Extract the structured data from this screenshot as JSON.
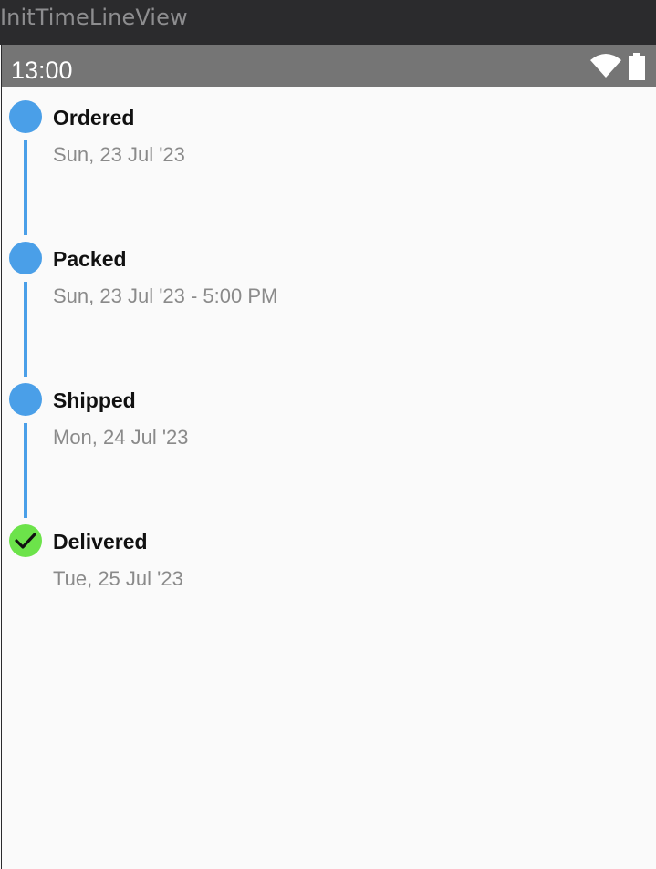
{
  "window": {
    "title": "InitTimeLineView"
  },
  "statusbar": {
    "time": "13:00",
    "icons": [
      "wifi-icon",
      "battery-icon"
    ]
  },
  "timeline": {
    "line_color": "#4a9fe8",
    "pending_color": "#4a9fe8",
    "done_color": "#6ce34a",
    "items": [
      {
        "title": "Ordered",
        "subtitle": "Sun, 23 Jul '23",
        "status": "pending"
      },
      {
        "title": "Packed",
        "subtitle": "Sun, 23 Jul '23 - 5:00 PM",
        "status": "pending"
      },
      {
        "title": "Shipped",
        "subtitle": "Mon, 24 Jul '23",
        "status": "pending"
      },
      {
        "title": "Delivered",
        "subtitle": "Tue, 25 Jul '23",
        "status": "done"
      }
    ]
  }
}
